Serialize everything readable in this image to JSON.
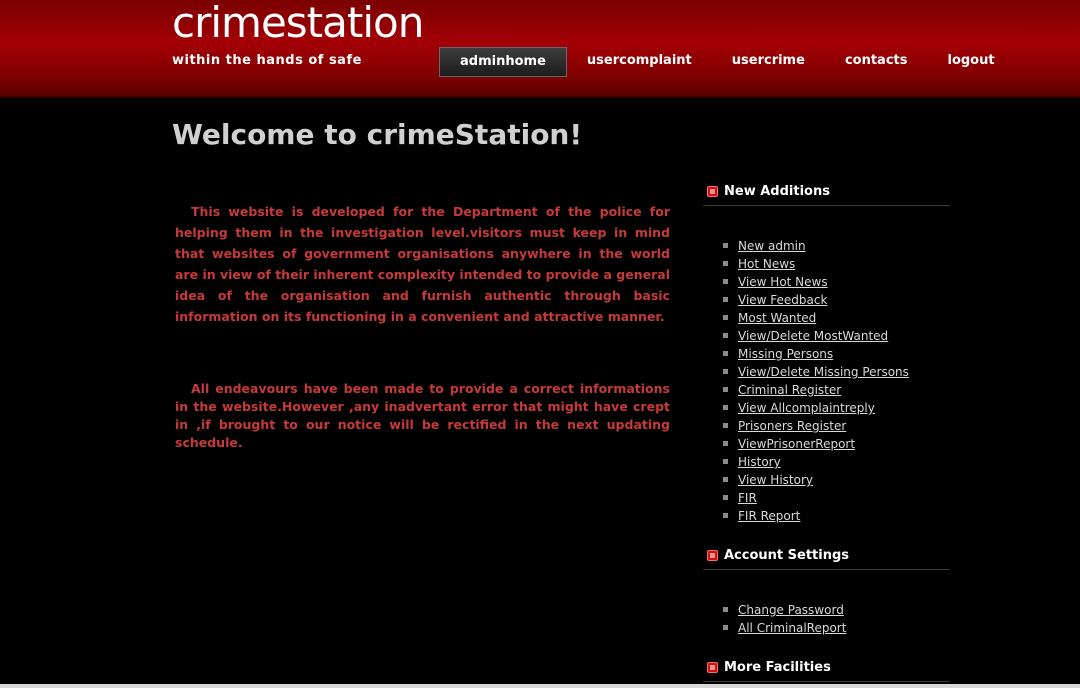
{
  "header": {
    "logo": "crimestation",
    "tagline": "within the hands of safe",
    "nav": [
      {
        "label": "adminhome",
        "active": true
      },
      {
        "label": "usercomplaint"
      },
      {
        "label": "usercrime"
      },
      {
        "label": "contacts"
      },
      {
        "label": "logout"
      }
    ]
  },
  "main": {
    "title": "Welcome to crimeStation!",
    "paragraph1": "This website is developed for the Department of the police for helping them in the investigation level.visitors must keep in mind that websites of government organisations anywhere in the world are in view of their inherent complexity intended to provide a general idea of the organisation and furnish authentic through basic information on its functioning in a convenient and attractive manner.",
    "paragraph2": "All endeavours have been made to provide a correct informations in the website.However ,any inadvertant error that might have crept in ,if brought to our notice will be rectified in the next updating schedule."
  },
  "sidebar": {
    "new_additions": {
      "heading": "New Additions",
      "links": [
        "New admin",
        "Hot News",
        "View Hot News",
        "View Feedback",
        "Most Wanted",
        "View/Delete MostWanted",
        "Missing Persons",
        "View/Delete Missing Persons",
        "Criminal Register",
        "View Allcomplaintreply",
        "Prisoners Register",
        "ViewPrisonerReport",
        "History",
        "View History",
        "FIR",
        "FIR Report"
      ]
    },
    "account_settings": {
      "heading": "Account Settings",
      "links": [
        "Change Password",
        "All CriminalReport"
      ]
    },
    "more_facilities": {
      "heading": "More Facilities"
    }
  },
  "colors": {
    "header_red": "#a30006",
    "paragraph_red": "#c73a3a",
    "background": "#000000"
  }
}
